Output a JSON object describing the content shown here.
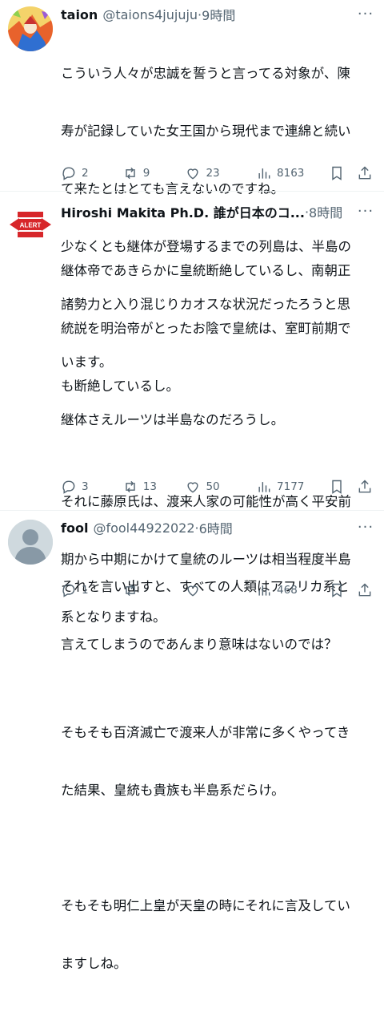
{
  "posts": [
    {
      "name": "taion",
      "handle": "@taions4jujuju",
      "separator": "·",
      "time": "9時間",
      "avatar_icon": "anime-character-avatar",
      "lines": [
        "こういう人々が忠誠を誓うと言ってる対象が、陳",
        "寿が記録していた女王国から現代まで連綿と続い",
        "て来たとはとても言えないのですね。",
        "少なくとも継体が登場するまでの列島は、半島の",
        "諸勢力と入り混じりカオスな状況だったろうと思",
        "います。",
        "継体さえルーツは半島なのだろうし。"
      ],
      "replies": "2",
      "reposts": "9",
      "likes": "23",
      "views": "8163"
    },
    {
      "name": "Hiroshi Makita Ph.D. 誰が日本のコ...",
      "handle": "",
      "separator": "·",
      "time": "8時間",
      "avatar_text": "ALERT",
      "lines": [
        "継体帝であきらかに皇統断絶しているし、南朝正",
        "統説を明治帝がとったお陰で皇統は、室町前期で",
        "も断絶しているし。",
        "",
        "それに藤原氏は、渡来人家の可能性が高く平安前",
        "期から中期にかけて皇統のルーツは相当程度半島",
        "系となりますね。",
        "",
        "そもそも百済滅亡で渡来人が非常に多くやってき",
        "た結果、皇統も貴族も半島系だらけ。",
        "",
        "そもそも明仁上皇が天皇の時にそれに言及してい",
        "ますしね。"
      ],
      "replies": "3",
      "reposts": "13",
      "likes": "50",
      "views": "7177"
    },
    {
      "name": "fool",
      "handle": "@fool44922022",
      "separator": "·",
      "time": "6時間",
      "avatar_icon": "default-person-avatar",
      "lines": [
        "それを言い出すと、すべての人類はアフリカ系と",
        "言えてしまうのであんまり意味はないのでは？"
      ],
      "replies": "1",
      "reposts": "",
      "likes": "",
      "views": "468"
    }
  ],
  "more_label": "···",
  "colors": {
    "text": "#0f1419",
    "muted": "#536471",
    "alert_red": "#d7262a"
  }
}
